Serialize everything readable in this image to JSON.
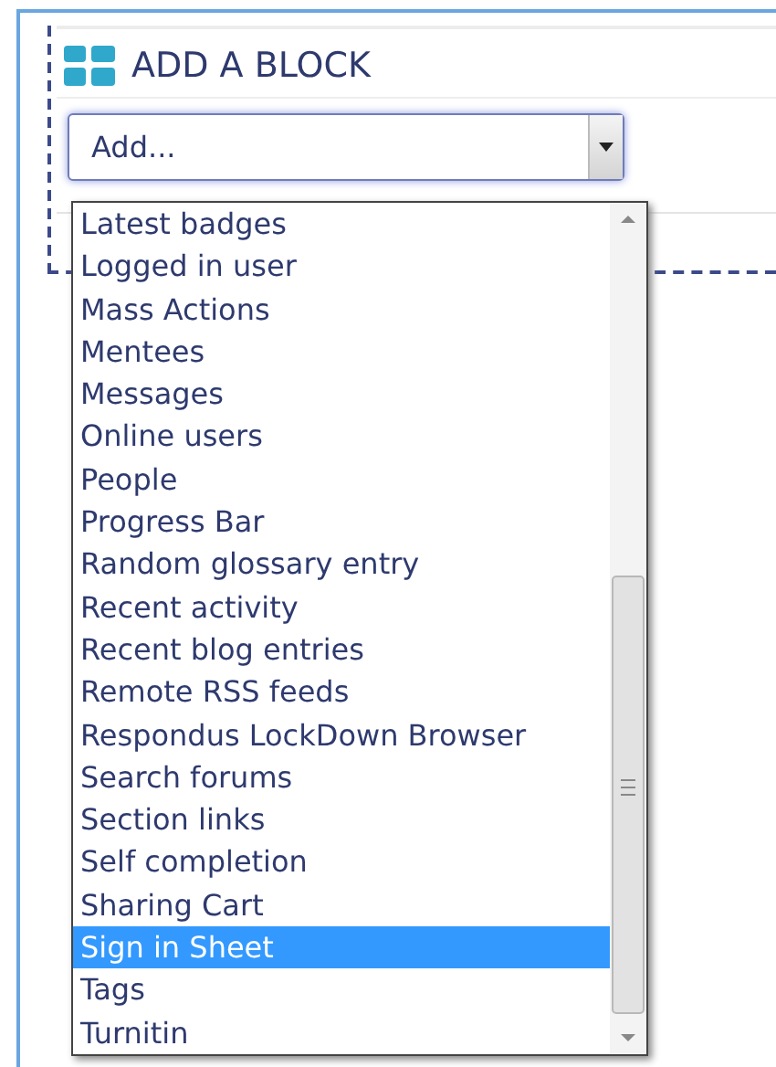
{
  "section": {
    "title": "ADD A BLOCK"
  },
  "select": {
    "value": "Add...",
    "expanded": true
  },
  "options": [
    {
      "label": "Latest badges",
      "selected": false
    },
    {
      "label": "Logged in user",
      "selected": false
    },
    {
      "label": "Mass Actions",
      "selected": false
    },
    {
      "label": "Mentees",
      "selected": false
    },
    {
      "label": "Messages",
      "selected": false
    },
    {
      "label": "Online users",
      "selected": false
    },
    {
      "label": "People",
      "selected": false
    },
    {
      "label": "Progress Bar",
      "selected": false
    },
    {
      "label": "Random glossary entry",
      "selected": false
    },
    {
      "label": "Recent activity",
      "selected": false
    },
    {
      "label": "Recent blog entries",
      "selected": false
    },
    {
      "label": "Remote RSS feeds",
      "selected": false
    },
    {
      "label": "Respondus LockDown Browser",
      "selected": false
    },
    {
      "label": "Search forums",
      "selected": false
    },
    {
      "label": "Section links",
      "selected": false
    },
    {
      "label": "Self completion",
      "selected": false
    },
    {
      "label": "Sharing Cart",
      "selected": false
    },
    {
      "label": "Sign in Sheet",
      "selected": true
    },
    {
      "label": "Tags",
      "selected": false
    },
    {
      "label": "Turnitin",
      "selected": false
    }
  ]
}
